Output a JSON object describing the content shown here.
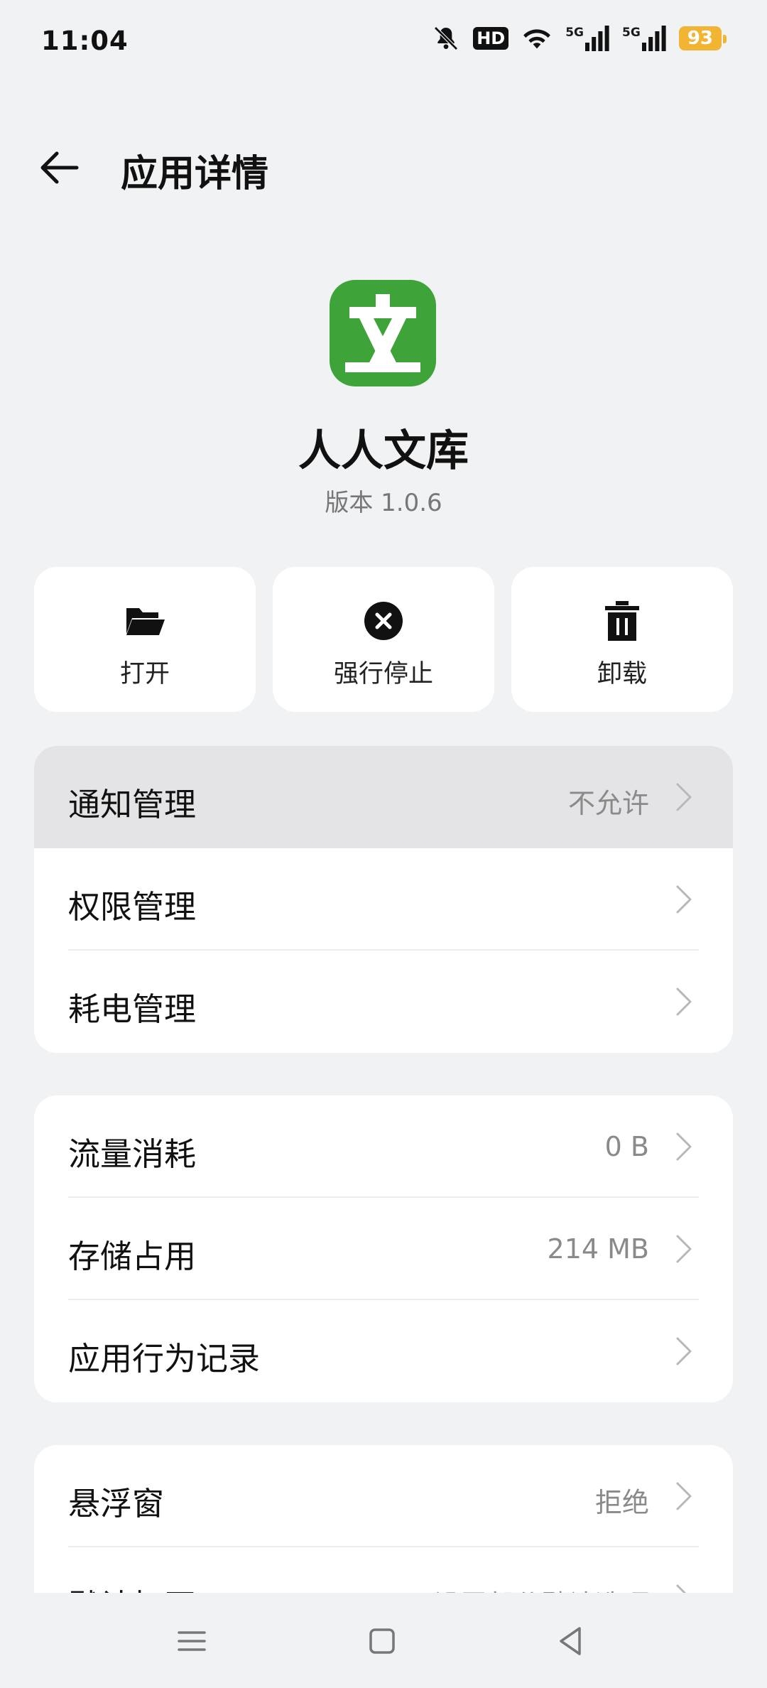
{
  "status_bar": {
    "time": "11:04",
    "hd_label": "HD",
    "signal_label_1": "5G",
    "signal_label_2": "5G",
    "battery": "93",
    "icons": [
      "bell-off-icon",
      "hd-icon",
      "wifi-icon",
      "signal-5g-icon",
      "signal-5g-icon",
      "battery-icon"
    ]
  },
  "header": {
    "title": "应用详情",
    "back_icon": "arrow-left-icon"
  },
  "app": {
    "name": "人人文库",
    "version": "版本 1.0.6",
    "icon_glyph": "文",
    "icon_color": "#3ea338"
  },
  "actions": [
    {
      "label": "打开",
      "icon": "folder-icon"
    },
    {
      "label": "强行停止",
      "icon": "close-circle-icon"
    },
    {
      "label": "卸载",
      "icon": "trash-icon"
    }
  ],
  "group1": [
    {
      "label": "通知管理",
      "value": "不允许"
    },
    {
      "label": "权限管理",
      "value": ""
    },
    {
      "label": "耗电管理",
      "value": ""
    }
  ],
  "group2": [
    {
      "label": "流量消耗",
      "value": "0 B"
    },
    {
      "label": "存储占用",
      "value": "214 MB"
    },
    {
      "label": "应用行为记录",
      "value": ""
    }
  ],
  "group3": [
    {
      "label": "悬浮窗",
      "value": "拒绝"
    },
    {
      "label": "默认打开",
      "value": "已设置部分默认选项"
    }
  ],
  "nav": {
    "icons": [
      "menu-icon",
      "home-icon",
      "back-triangle-icon"
    ]
  },
  "colors": {
    "background": "#f1f2f4",
    "card": "#ffffff",
    "accent_green": "#3ea338",
    "battery": "#f2b533"
  }
}
